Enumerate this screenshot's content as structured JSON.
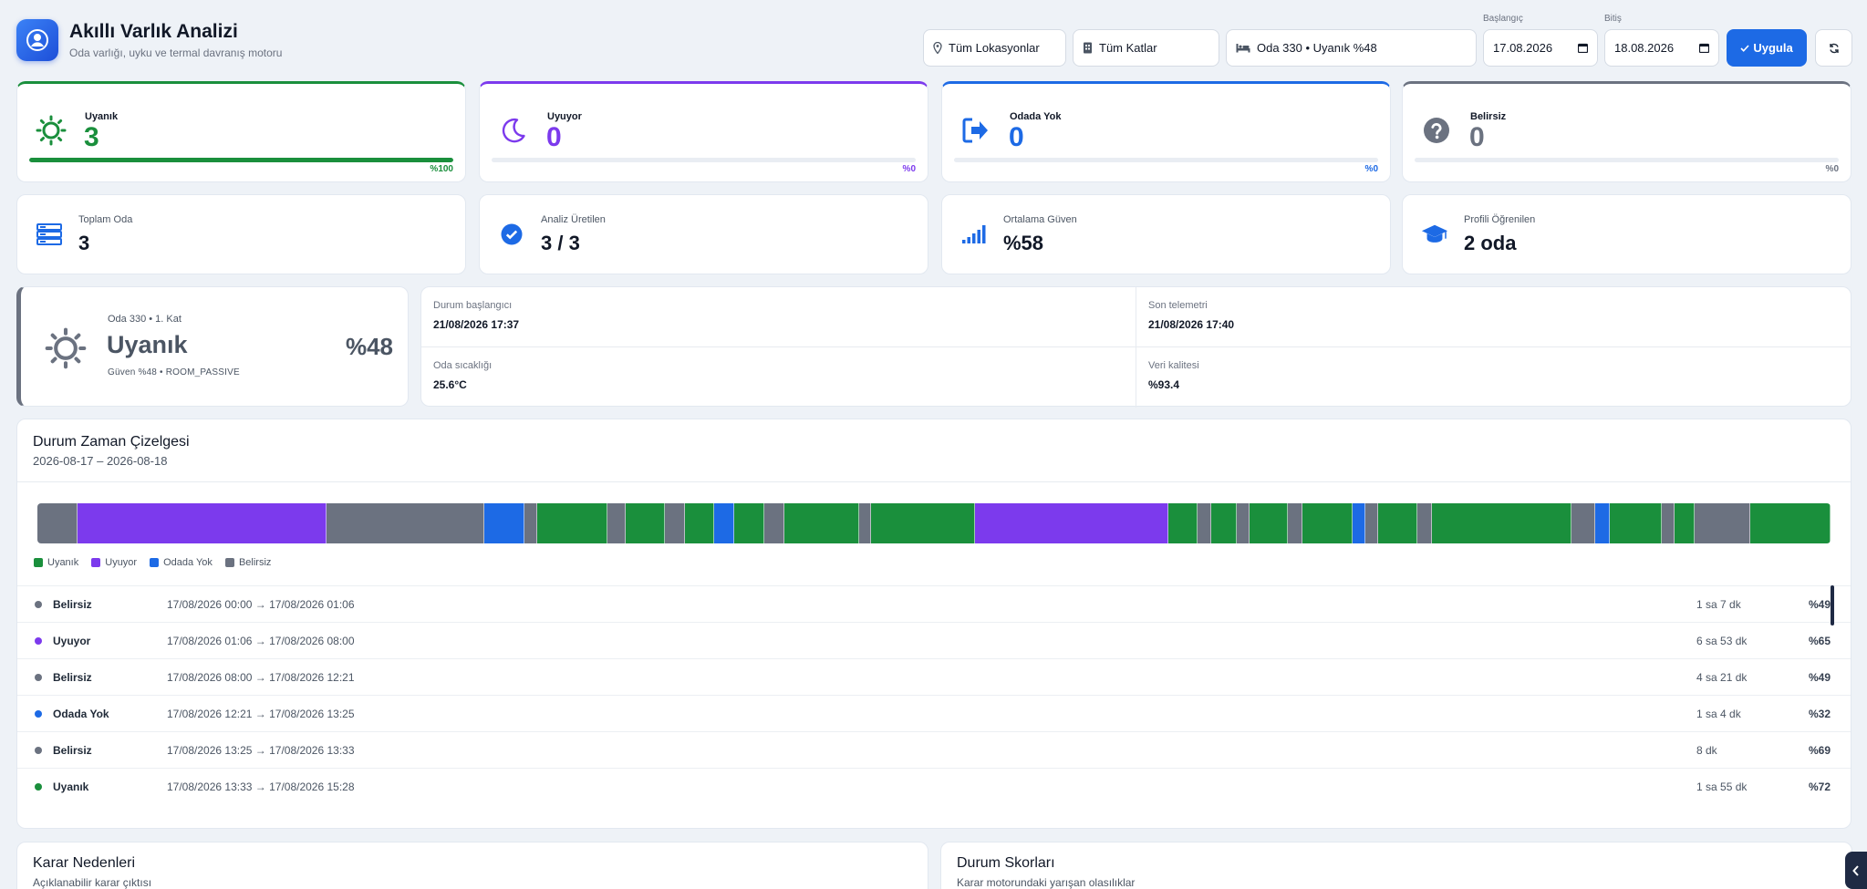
{
  "header": {
    "title": "Akıllı Varlık Analizi",
    "subtitle": "Oda varlığı, uyku ve termal davranış motoru"
  },
  "filters": {
    "location": "Tüm Lokasyonlar",
    "floor": "Tüm Katlar",
    "room": "Oda 330 • Uyanık %48",
    "start_label": "Başlangıç",
    "start_date": "17.08.2026",
    "end_label": "Bitiş",
    "end_date": "18.08.2026",
    "apply_label": "Uygula"
  },
  "status_cards": [
    {
      "label": "Uyanık",
      "value": "3",
      "percent_text": "%100",
      "fraction": 1.0,
      "color": "#1a8f3c",
      "icon": "sun-icon"
    },
    {
      "label": "Uyuyor",
      "value": "0",
      "percent_text": "%0",
      "fraction": 0.0,
      "color": "#7c3aed",
      "icon": "moon-icon"
    },
    {
      "label": "Odada Yok",
      "value": "0",
      "percent_text": "%0",
      "fraction": 0.0,
      "color": "#1d6ae5",
      "icon": "exit-icon"
    },
    {
      "label": "Belirsiz",
      "value": "0",
      "percent_text": "%0",
      "fraction": 0.0,
      "color": "#6b7280",
      "icon": "question-icon"
    }
  ],
  "summary_cards": [
    {
      "label": "Toplam Oda",
      "value": "3",
      "icon": "server-icon"
    },
    {
      "label": "Analiz Üretilen",
      "value": "3 / 3",
      "icon": "check-circle-icon"
    },
    {
      "label": "Ortalama Güven",
      "value": "%58",
      "icon": "signal-icon"
    },
    {
      "label": "Profili Öğrenilen",
      "value": "2 oda",
      "icon": "graduation-cap-icon"
    }
  ],
  "current_state": {
    "meta": "Oda 330 • 1. Kat",
    "state": "Uyanık",
    "percent": "%48",
    "footer": "Güven %48 • ROOM_PASSIVE"
  },
  "info": {
    "state_start_label": "Durum başlangıcı",
    "state_start_value": "21/08/2026 17:37",
    "last_telemetry_label": "Son telemetri",
    "last_telemetry_value": "21/08/2026 17:40",
    "room_temp_label": "Oda sıcaklığı",
    "room_temp_value": "25.6°C",
    "data_quality_label": "Veri kalitesi",
    "data_quality_value": "%93.4"
  },
  "timeline": {
    "title": "Durum Zaman Çizelgesi",
    "range": "2026-08-17 – 2026-08-18",
    "colors": {
      "Uyanık": "#1a8f3c",
      "Uyuyor": "#7c3aed",
      "Odada Yok": "#1d6ae5",
      "Belirsiz": "#6b7280"
    },
    "legend": [
      "Uyanık",
      "Uyuyor",
      "Odada Yok",
      "Belirsiz"
    ],
    "segments": [
      {
        "state": "Belirsiz",
        "w": 2.2
      },
      {
        "state": "Uyuyor",
        "w": 13.8
      },
      {
        "state": "Belirsiz",
        "w": 8.7
      },
      {
        "state": "Odada Yok",
        "w": 2.2
      },
      {
        "state": "Belirsiz",
        "w": 0.7
      },
      {
        "state": "Uyanık",
        "w": 3.9
      },
      {
        "state": "Belirsiz",
        "w": 1.0
      },
      {
        "state": "Uyanık",
        "w": 2.2
      },
      {
        "state": "Belirsiz",
        "w": 1.1
      },
      {
        "state": "Uyanık",
        "w": 1.6
      },
      {
        "state": "Odada Yok",
        "w": 1.1
      },
      {
        "state": "Uyanık",
        "w": 1.7
      },
      {
        "state": "Belirsiz",
        "w": 1.1
      },
      {
        "state": "Uyanık",
        "w": 4.1
      },
      {
        "state": "Belirsiz",
        "w": 0.7
      },
      {
        "state": "Uyanık",
        "w": 5.7
      },
      {
        "state": "Uyuyor",
        "w": 10.7
      },
      {
        "state": "Uyanık",
        "w": 1.6
      },
      {
        "state": "Belirsiz",
        "w": 0.8
      },
      {
        "state": "Uyanık",
        "w": 1.4
      },
      {
        "state": "Belirsiz",
        "w": 0.7
      },
      {
        "state": "Uyanık",
        "w": 2.1
      },
      {
        "state": "Belirsiz",
        "w": 0.8
      },
      {
        "state": "Uyanık",
        "w": 2.8
      },
      {
        "state": "Odada Yok",
        "w": 0.7
      },
      {
        "state": "Belirsiz",
        "w": 0.7
      },
      {
        "state": "Uyanık",
        "w": 2.2
      },
      {
        "state": "Belirsiz",
        "w": 0.8
      },
      {
        "state": "Uyanık",
        "w": 7.7
      },
      {
        "state": "Belirsiz",
        "w": 1.3
      },
      {
        "state": "Odada Yok",
        "w": 0.8
      },
      {
        "state": "Uyanık",
        "w": 2.9
      },
      {
        "state": "Belirsiz",
        "w": 0.7
      },
      {
        "state": "Uyanık",
        "w": 1.1
      },
      {
        "state": "Belirsiz",
        "w": 3.1
      },
      {
        "state": "Uyanık",
        "w": 4.4
      }
    ],
    "rows": [
      {
        "state": "Belirsiz",
        "time": "17/08/2026 00:00 → 17/08/2026 01:06",
        "duration": "1 sa 7 dk",
        "confidence": "%49"
      },
      {
        "state": "Uyuyor",
        "time": "17/08/2026 01:06 → 17/08/2026 08:00",
        "duration": "6 sa 53 dk",
        "confidence": "%65"
      },
      {
        "state": "Belirsiz",
        "time": "17/08/2026 08:00 → 17/08/2026 12:21",
        "duration": "4 sa 21 dk",
        "confidence": "%49"
      },
      {
        "state": "Odada Yok",
        "time": "17/08/2026 12:21 → 17/08/2026 13:25",
        "duration": "1 sa 4 dk",
        "confidence": "%32"
      },
      {
        "state": "Belirsiz",
        "time": "17/08/2026 13:25 → 17/08/2026 13:33",
        "duration": "8 dk",
        "confidence": "%69"
      },
      {
        "state": "Uyanık",
        "time": "17/08/2026 13:33 → 17/08/2026 15:28",
        "duration": "1 sa 55 dk",
        "confidence": "%72"
      }
    ]
  },
  "reasons": {
    "title": "Karar Nedenleri",
    "subtitle": "Açıklanabilir karar çıktısı"
  },
  "scores": {
    "title": "Durum Skorları",
    "subtitle": "Karar motorundaki yarışan olasılıklar"
  }
}
